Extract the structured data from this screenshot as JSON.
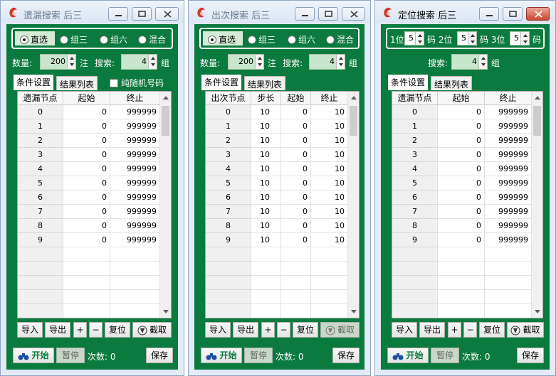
{
  "windows": [
    {
      "title": "遗漏搜索 后三",
      "radios": [
        "直选",
        "组三",
        "组六",
        "混合"
      ],
      "selected_radio": "直选",
      "count_label": "数量:",
      "count_value": "200",
      "count_unit": "注",
      "search_label": "搜索:",
      "search_value": "4",
      "search_unit": "组",
      "tab_conditions": "条件设置",
      "tab_results": "结果列表",
      "checkbox_label": "纯随机号码",
      "columns": [
        "遗漏节点",
        "起始",
        "终止"
      ],
      "rows": [
        [
          "0",
          "0",
          "999999"
        ],
        [
          "1",
          "0",
          "999999"
        ],
        [
          "2",
          "0",
          "999999"
        ],
        [
          "3",
          "0",
          "999999"
        ],
        [
          "4",
          "0",
          "999999"
        ],
        [
          "5",
          "0",
          "999999"
        ],
        [
          "6",
          "0",
          "999999"
        ],
        [
          "7",
          "0",
          "999999"
        ],
        [
          "8",
          "0",
          "999999"
        ],
        [
          "9",
          "0",
          "999999"
        ]
      ],
      "btn_import": "导入",
      "btn_export": "导出",
      "btn_plus": "+",
      "btn_minus": "−",
      "btn_reset": "复位",
      "btn_capture": "截取",
      "btn_start": "开始",
      "btn_pause": "暂停",
      "status_count": "次数: 0",
      "btn_save": "保存"
    },
    {
      "title": "出次搜索 后三",
      "radios": [
        "直选",
        "组三",
        "组六",
        "混合"
      ],
      "selected_radio": "直选",
      "count_label": "数量:",
      "count_value": "200",
      "count_unit": "注",
      "search_label": "搜索:",
      "search_value": "4",
      "search_unit": "组",
      "tab_conditions": "条件设置",
      "tab_results": "结果列表",
      "columns": [
        "出次节点",
        "步长",
        "起始",
        "终止"
      ],
      "rows": [
        [
          "0",
          "10",
          "0",
          "10"
        ],
        [
          "1",
          "10",
          "0",
          "10"
        ],
        [
          "2",
          "10",
          "0",
          "10"
        ],
        [
          "3",
          "10",
          "0",
          "10"
        ],
        [
          "4",
          "10",
          "0",
          "10"
        ],
        [
          "5",
          "10",
          "0",
          "10"
        ],
        [
          "6",
          "10",
          "0",
          "10"
        ],
        [
          "7",
          "10",
          "0",
          "10"
        ],
        [
          "8",
          "10",
          "0",
          "10"
        ],
        [
          "9",
          "10",
          "0",
          "10"
        ]
      ],
      "btn_import": "导入",
      "btn_export": "导出",
      "btn_plus": "+",
      "btn_minus": "−",
      "btn_reset": "复位",
      "btn_capture": "截取",
      "btn_start": "开始",
      "btn_pause": "暂停",
      "status_count": "次数: 0",
      "btn_save": "保存"
    },
    {
      "title": "定位搜索 后三",
      "pos1_label": "1位",
      "pos1_value": "5",
      "pos2_label": "码 2位",
      "pos2_value": "5",
      "pos3_label": "码 3位",
      "pos3_value": "5",
      "pos_unit": "码",
      "search_label": "搜索:",
      "search_value": "4",
      "search_unit": "组",
      "tab_conditions": "条件设置",
      "tab_results": "结果列表",
      "columns": [
        "遗漏节点",
        "起始",
        "终止"
      ],
      "rows": [
        [
          "0",
          "0",
          "999999"
        ],
        [
          "1",
          "0",
          "999999"
        ],
        [
          "2",
          "0",
          "999999"
        ],
        [
          "3",
          "0",
          "999999"
        ],
        [
          "4",
          "0",
          "999999"
        ],
        [
          "5",
          "0",
          "999999"
        ],
        [
          "6",
          "0",
          "999999"
        ],
        [
          "7",
          "0",
          "999999"
        ],
        [
          "8",
          "0",
          "999999"
        ],
        [
          "9",
          "0",
          "999999"
        ]
      ],
      "btn_import": "导入",
      "btn_export": "导出",
      "btn_plus": "+",
      "btn_minus": "−",
      "btn_reset": "复位",
      "btn_capture": "截取",
      "btn_start": "开始",
      "btn_pause": "暂停",
      "status_count": "次数: 0",
      "btn_save": "保存"
    }
  ],
  "colors": {
    "panel_green": "#0b7a3e",
    "title_bar": "#dbe5f3",
    "close_active": "#c94a31",
    "spin_highlight": "#c7e6cd"
  },
  "icons": [
    "app-logo-icon",
    "minimize-icon",
    "maximize-icon",
    "close-icon",
    "binoculars-icon",
    "capture-icon"
  ]
}
